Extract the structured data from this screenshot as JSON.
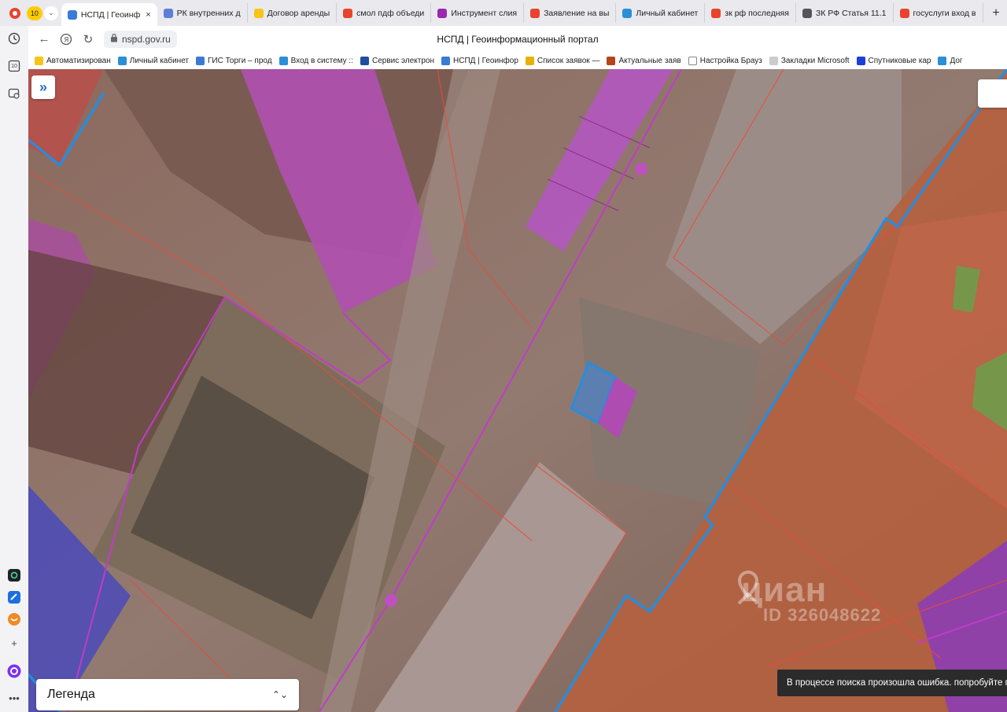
{
  "browser": {
    "tab_counter": "10",
    "tabs": [
      {
        "label": "НСПД | Геоинф",
        "fav_color": "#3a7bd5",
        "active": true
      },
      {
        "label": "РК внутренних д",
        "fav_color": "#5b7fd6"
      },
      {
        "label": "Договор аренды",
        "fav_color": "#f5c518"
      },
      {
        "label": "смол пдф объеди",
        "fav_color": "#e8432d"
      },
      {
        "label": "Инструмент слия",
        "fav_color": "#9c27b0"
      },
      {
        "label": "Заявление на вы",
        "fav_color": "#e8432d"
      },
      {
        "label": "Личный кабинет",
        "fav_color": "#2a8fd6"
      },
      {
        "label": "зк рф последняя",
        "fav_color": "#e8432d"
      },
      {
        "label": "ЗК РФ Статья 11.1",
        "fav_color": "#555555"
      },
      {
        "label": "госуслуги вход в",
        "fav_color": "#e8432d"
      }
    ],
    "new_tab": "+",
    "url": "nspd.gov.ru",
    "page_title": "НСПД | Геоинформационный портал",
    "bookmarks": [
      {
        "label": "Автоматизирован",
        "color": "#f5c518"
      },
      {
        "label": "Личный кабинет",
        "color": "#2a8fd6"
      },
      {
        "label": "ГИС Торги – прод",
        "color": "#3a7bd5"
      },
      {
        "label": "Вход в систему :: ",
        "color": "#2a8fd6"
      },
      {
        "label": "Сервис электрон",
        "color": "#1e4fa0"
      },
      {
        "label": "НСПД | Геоинфор",
        "color": "#3a7bd5"
      },
      {
        "label": "Список заявок —",
        "color": "#e8b000"
      },
      {
        "label": "Актуальные заяв",
        "color": "#b5441c"
      },
      {
        "label": "Настройка Брауз",
        "color": "#ffffff"
      },
      {
        "label": "Закладки Microsoft",
        "color": "#cccccc"
      },
      {
        "label": "Спутниковые кар",
        "color": "#1e3fd6"
      },
      {
        "label": "Дог",
        "color": "#2a8fd6"
      }
    ],
    "sidebar_badge": "10"
  },
  "map": {
    "expand_icon": "»",
    "legend_label": "Легенда",
    "legend_arrows": "⌃⌄",
    "toast_text": "В процессе поиска произошла ошибка. попробуйте п",
    "watermark_brand": "циан",
    "watermark_id": "ID 326048622"
  },
  "colors": {
    "boundary_blue": "#1e8fe8",
    "parcel_magenta": "#c03cc8",
    "parcel_red": "#e84b3a"
  }
}
